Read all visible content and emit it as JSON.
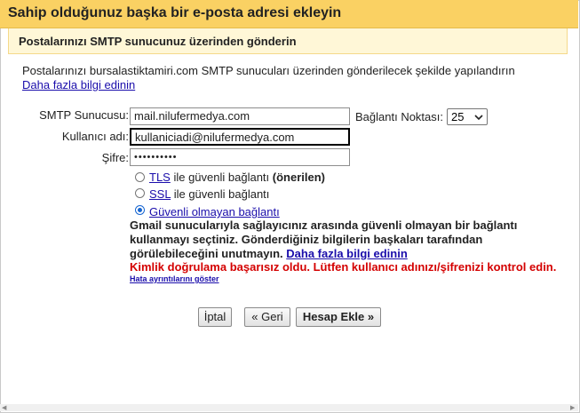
{
  "dialog": {
    "title": "Sahip olduğunuz başka bir e-posta adresi ekleyin",
    "subtitle": "Postalarınızı SMTP sunucunuz üzerinden gönderin",
    "description": "Postalarınızı bursalastiktamiri.com SMTP sunucuları üzerinden gönderilecek şekilde yapılandırın",
    "learn_more": "Daha fazla bilgi edinin"
  },
  "form": {
    "smtp_label": "SMTP Sunucusu:",
    "smtp_value": "mail.nilufermedya.com",
    "port_label": "Bağlantı Noktası:",
    "port_value": "25",
    "user_label": "Kullanıcı adı:",
    "user_value": "kullaniciadi@nilufermedya.com",
    "pass_label": "Şifre:",
    "pass_value": "••••••••••"
  },
  "options": {
    "tls_link": "TLS",
    "tls_text": " ile güvenli bağlantı ",
    "tls_recommended": "(önerilen)",
    "ssl_link": "SSL",
    "ssl_text": " ile güvenli bağlantı",
    "insecure_link": "Güvenli olmayan bağlantı",
    "selected": "insecure"
  },
  "warning": {
    "text": "Gmail sunucularıyla sağlayıcınız arasında güvenli olmayan bir bağlantı kullanmayı seçtiniz. Gönderdiğiniz bilgilerin başkaları tarafından görülebileceğini unutmayın.",
    "link": "Daha fazla bilgi edinin"
  },
  "error": {
    "text": "Kimlik doğrulama başarısız oldu. Lütfen kullanıcı adınızı/şifrenizi kontrol edin.",
    "details_link": "Hata ayrıntılarını göster"
  },
  "buttons": {
    "cancel": "İptal",
    "back": "« Geri",
    "add": "Hesap Ekle »"
  }
}
